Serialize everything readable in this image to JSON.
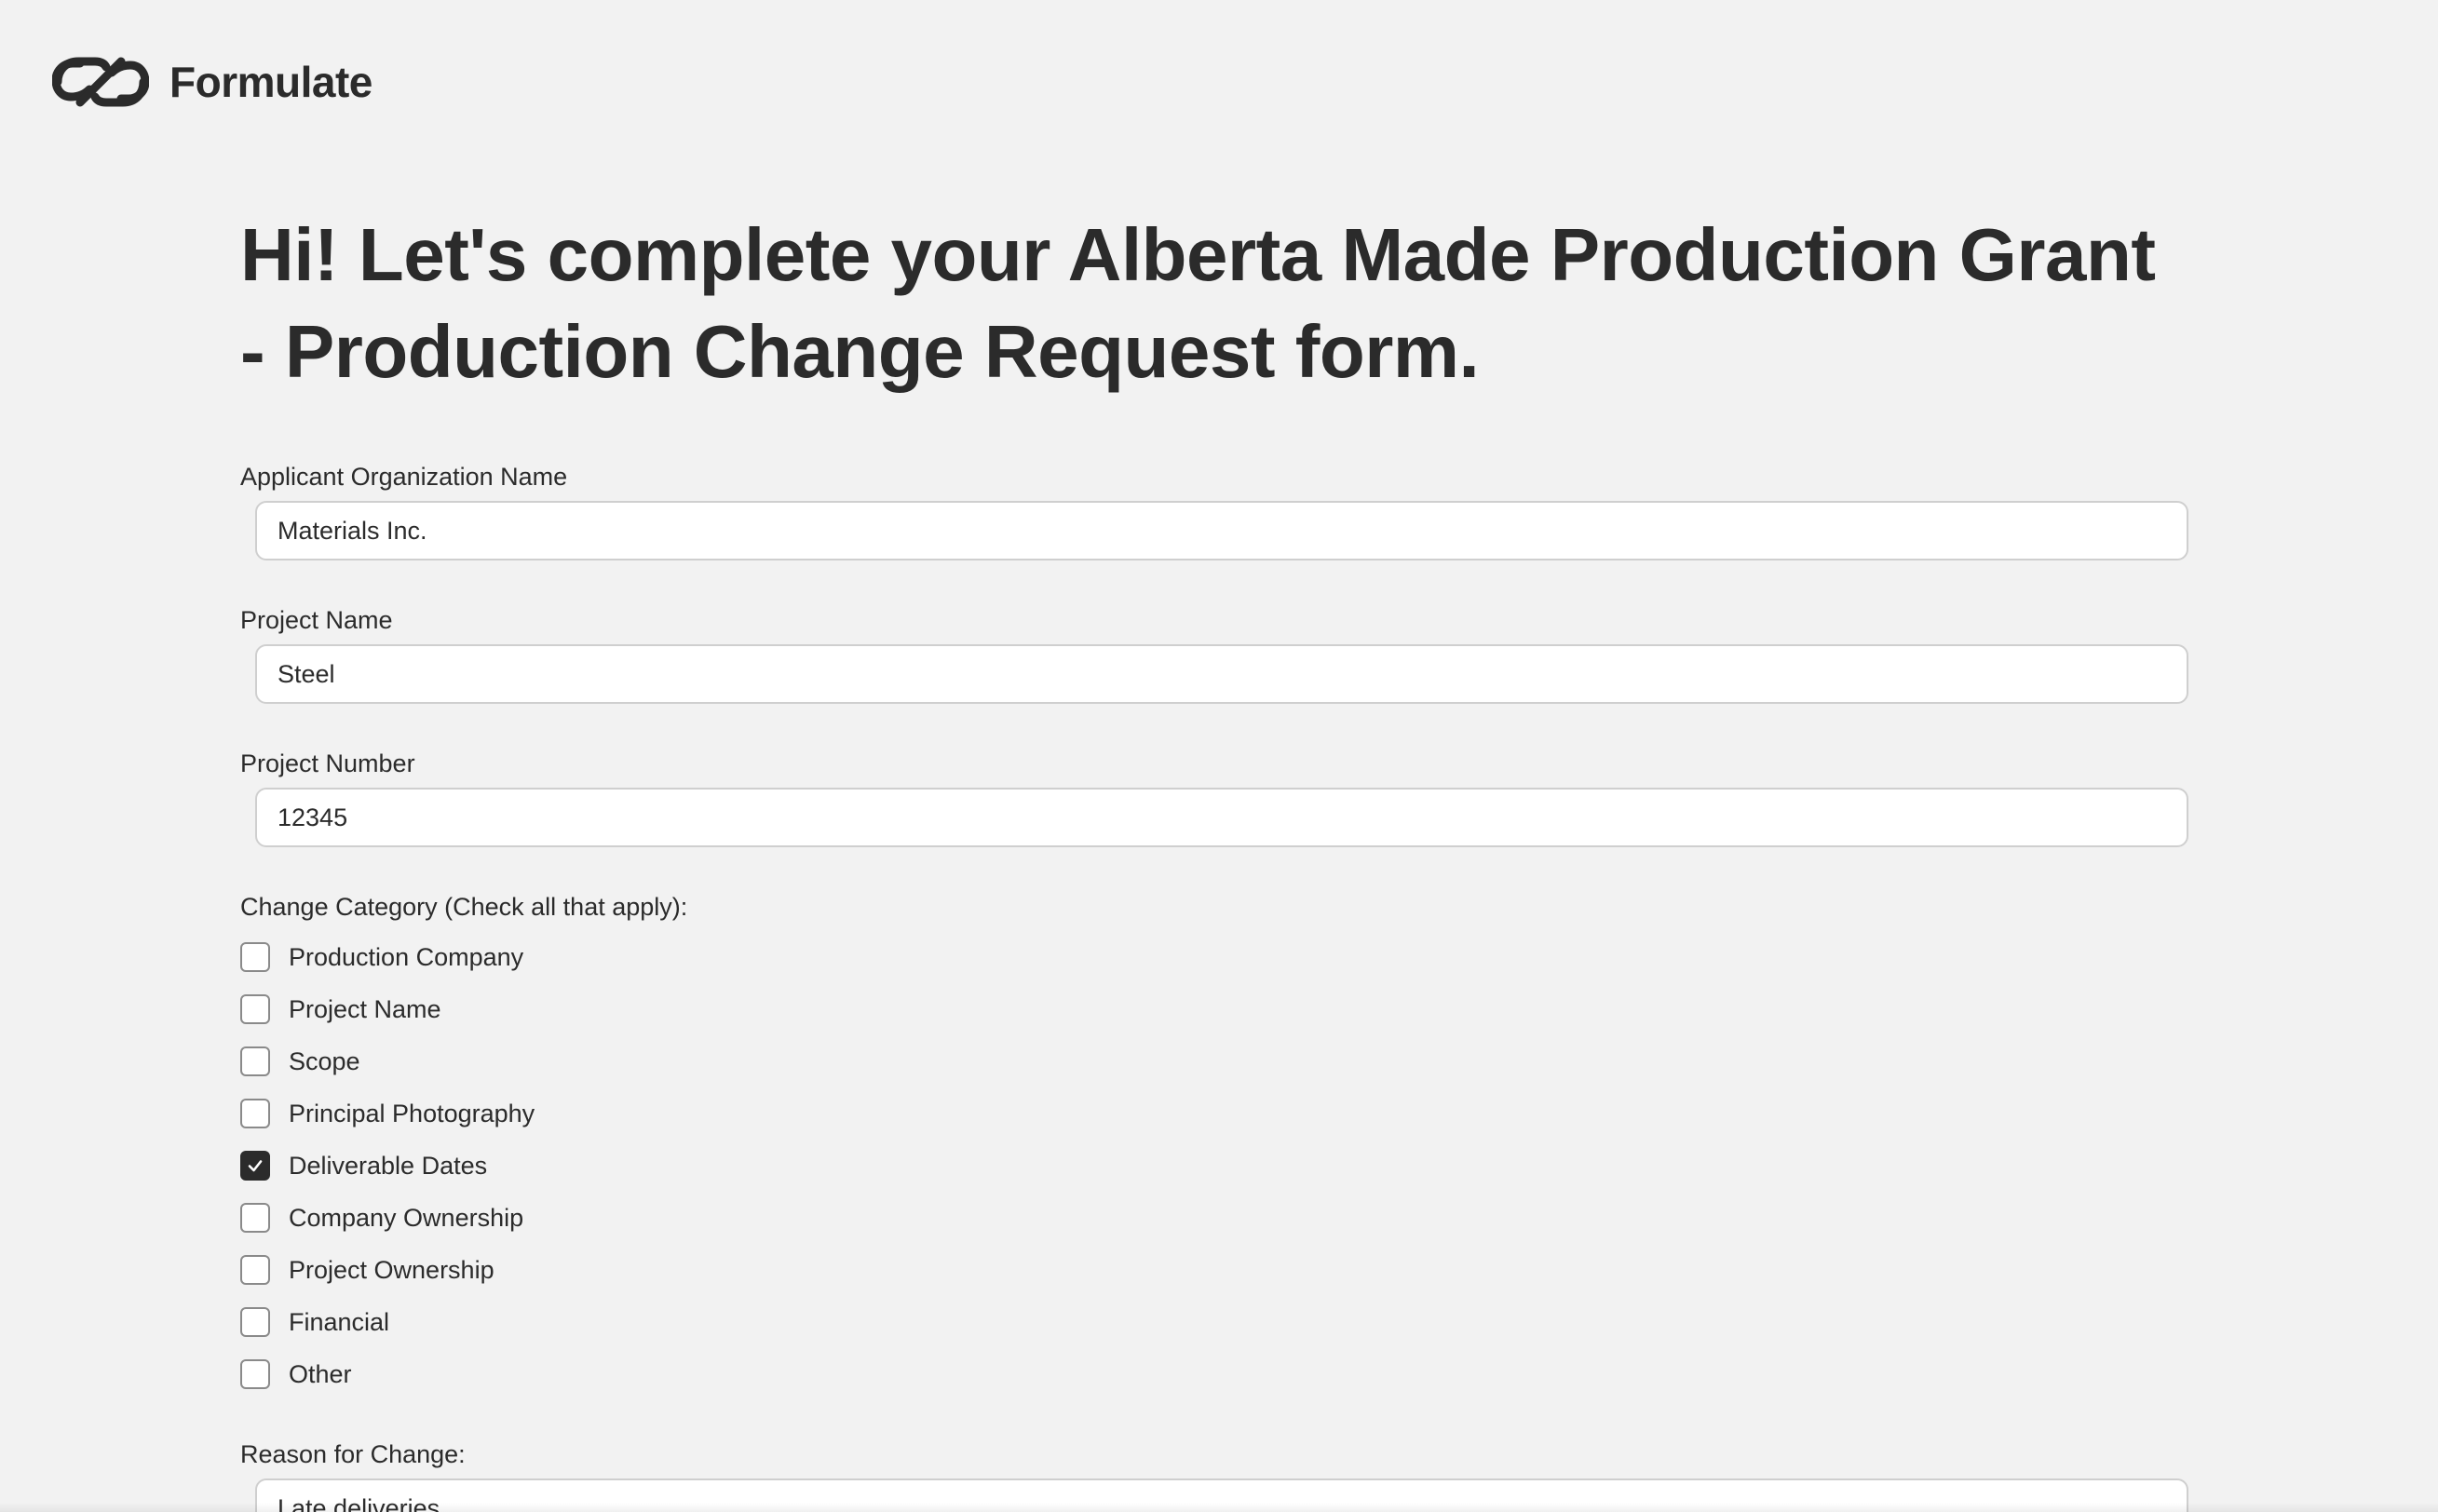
{
  "brand": {
    "name": "Formulate",
    "logo_icon": "infinity-link-logo-icon"
  },
  "form": {
    "title": "Hi! Let's complete your Alberta Made Production Grant - Production Change Request form.",
    "fields": {
      "org_name": {
        "label": "Applicant Organization Name",
        "value": "Materials Inc."
      },
      "project_name": {
        "label": "Project Name",
        "value": "Steel"
      },
      "project_number": {
        "label": "Project Number",
        "value": "12345"
      }
    },
    "change_category": {
      "label": "Change Category (Check all that apply):",
      "options": [
        {
          "label": "Production Company",
          "checked": false
        },
        {
          "label": "Project Name",
          "checked": false
        },
        {
          "label": "Scope",
          "checked": false
        },
        {
          "label": "Principal Photography",
          "checked": false
        },
        {
          "label": "Deliverable Dates",
          "checked": true
        },
        {
          "label": "Company Ownership",
          "checked": false
        },
        {
          "label": "Project Ownership",
          "checked": false
        },
        {
          "label": "Financial",
          "checked": false
        },
        {
          "label": "Other",
          "checked": false
        }
      ]
    },
    "reason": {
      "label": "Reason for Change:",
      "value": "Late deliveries"
    }
  },
  "colors": {
    "background": "#f2f2f2",
    "text": "#2b2b2b",
    "input_border": "#cfcfcf",
    "checkbox_checked": "#2b2b2b"
  }
}
